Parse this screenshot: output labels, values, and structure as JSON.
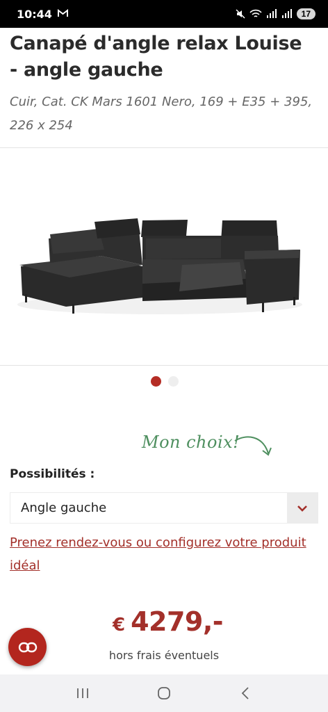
{
  "status_bar": {
    "time": "10:44",
    "notification_icon": "gmail-icon",
    "battery": "17"
  },
  "product": {
    "title": "Canapé d'angle relax Louise - angle gauche",
    "subtitle": "Cuir, Cat. CK Mars 1601 Nero, 169 + E35 + 395, 226 x 254",
    "image_count": 2,
    "active_image": 1
  },
  "choice_note": "Mon choix!",
  "options": {
    "label": "Possibilités :",
    "selected": "Angle gauche"
  },
  "configure_link": "Prenez rendez-vous ou configurez votre produit idéal",
  "price": {
    "currency": "€",
    "amount": "4279,-",
    "note": "hors frais éventuels"
  },
  "colors": {
    "accent": "#b52d25",
    "link": "#a3302a",
    "green_note": "#4e8f5f"
  }
}
